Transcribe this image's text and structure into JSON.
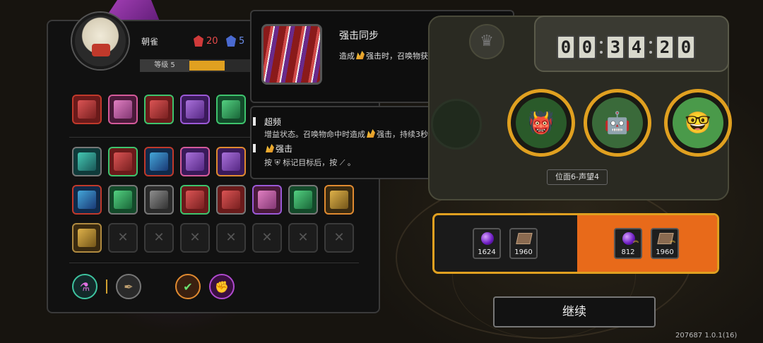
{
  "character": {
    "name": "朝雀",
    "red_stat": "20",
    "blue_stat": "5",
    "level_label": "等级 5",
    "level_progress": 0.55
  },
  "skills_row1": [
    {
      "name": "skill-slot-1",
      "color": "red"
    },
    {
      "name": "skill-slot-2",
      "color": "pink"
    },
    {
      "name": "skill-slot-3",
      "color": "red",
      "border": "green"
    },
    {
      "name": "skill-slot-4",
      "color": "purple"
    },
    {
      "name": "skill-slot-5",
      "color": "green"
    }
  ],
  "skills_row2": [
    {
      "color": "teal",
      "border": "gray"
    },
    {
      "color": "red",
      "border": "green"
    },
    {
      "color": "blue",
      "border": "red"
    },
    {
      "color": "purple",
      "border": "pink"
    },
    {
      "color": "purple",
      "border": "orange"
    }
  ],
  "skills_row3": [
    {
      "color": "blue",
      "border": "red"
    },
    {
      "color": "green",
      "border": "gray"
    },
    {
      "color": "gray",
      "border": "gray"
    },
    {
      "color": "red",
      "border": "green"
    },
    {
      "color": "red",
      "border": "gray"
    },
    {
      "color": "pink",
      "border": "purple"
    },
    {
      "color": "green",
      "border": "gray"
    },
    {
      "color": "gold",
      "border": "orange"
    }
  ],
  "skills_row4": [
    {
      "color": "gold",
      "border": "gold"
    },
    {
      "locked": true
    },
    {
      "locked": true
    },
    {
      "locked": true
    },
    {
      "locked": true
    },
    {
      "locked": true
    },
    {
      "locked": true
    },
    {
      "locked": true
    }
  ],
  "tooltip": {
    "title": "强击同步",
    "desc_pre": "造成",
    "desc_post": "强击时，召唤物获得超频。",
    "sub1_title": "超频",
    "sub1_pre": "增益状态。召唤物命中时造成",
    "sub1_post": "强击，持续3秒。",
    "sub2_title": "强击",
    "sub2_text": "按 ⛨ 标记目标后，按 ⟋ 。"
  },
  "timer": {
    "digits": [
      "0",
      "0",
      "3",
      "4",
      "2",
      "0"
    ]
  },
  "stage_label": "位面6-声望4",
  "rewards": {
    "left": [
      {
        "type": "orb",
        "value": "1624"
      },
      {
        "type": "book",
        "value": "1960"
      }
    ],
    "right": [
      {
        "type": "orb",
        "value": "812"
      },
      {
        "type": "book",
        "value": "1960"
      }
    ]
  },
  "continue_label": "继续",
  "version": "207687 1.0.1(16)"
}
